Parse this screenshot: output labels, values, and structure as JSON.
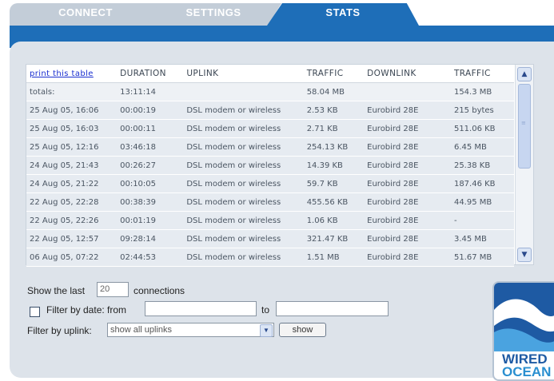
{
  "tabs": [
    {
      "label": "CONNECT"
    },
    {
      "label": "SETTINGS"
    },
    {
      "label": "STATS",
      "active": true
    }
  ],
  "table": {
    "print_link": "print this table",
    "headers": [
      "DURATION",
      "UPLINK",
      "TRAFFIC",
      "DOWNLINK",
      "TRAFFIC"
    ],
    "totals": [
      "totals:",
      "13:11:14",
      "",
      "58.04 MB",
      "",
      "154.3 MB"
    ],
    "rows": [
      [
        "25 Aug 05, 16:06",
        "00:00:19",
        "DSL modem or wireless",
        "2.53 KB",
        "Eurobird 28E",
        "215 bytes"
      ],
      [
        "25 Aug 05, 16:03",
        "00:00:11",
        "DSL modem or wireless",
        "2.71 KB",
        "Eurobird 28E",
        "511.06 KB"
      ],
      [
        "25 Aug 05, 12:16",
        "03:46:18",
        "DSL modem or wireless",
        "254.13 KB",
        "Eurobird 28E",
        "6.45 MB"
      ],
      [
        "24 Aug 05, 21:43",
        "00:26:27",
        "DSL modem or wireless",
        "14.39 KB",
        "Eurobird 28E",
        "25.38 KB"
      ],
      [
        "24 Aug 05, 21:22",
        "00:10:05",
        "DSL modem or wireless",
        "59.7 KB",
        "Eurobird 28E",
        "187.46 KB"
      ],
      [
        "22 Aug 05, 22:28",
        "00:38:39",
        "DSL modem or wireless",
        "455.56 KB",
        "Eurobird 28E",
        "44.95 MB"
      ],
      [
        "22 Aug 05, 22:26",
        "00:01:19",
        "DSL modem or wireless",
        "1.06 KB",
        "Eurobird 28E",
        "-"
      ],
      [
        "22 Aug 05, 12:57",
        "09:28:14",
        "DSL modem or wireless",
        "321.47 KB",
        "Eurobird 28E",
        "3.45 MB"
      ],
      [
        "06 Aug 05, 07:22",
        "02:44:53",
        "DSL modem or wireless",
        "1.51 MB",
        "Eurobird 28E",
        "51.67 MB"
      ]
    ]
  },
  "controls": {
    "show_last_prefix": "Show the last",
    "show_last_value": "20",
    "show_last_suffix": "connections",
    "filter_date_label": "Filter by date:  from",
    "from_value": "",
    "to_label": "to",
    "to_value": "",
    "filter_uplink_label": "Filter by uplink:",
    "uplink_selected": "show all uplinks",
    "show_button": "show"
  },
  "logo": {
    "line1": "WIRED",
    "line2": "OCEAN"
  },
  "colors": {
    "accent": "#1e6eb8",
    "panel": "#dde3ea",
    "row": "#e6ebf1",
    "link": "#1a2fd0"
  }
}
